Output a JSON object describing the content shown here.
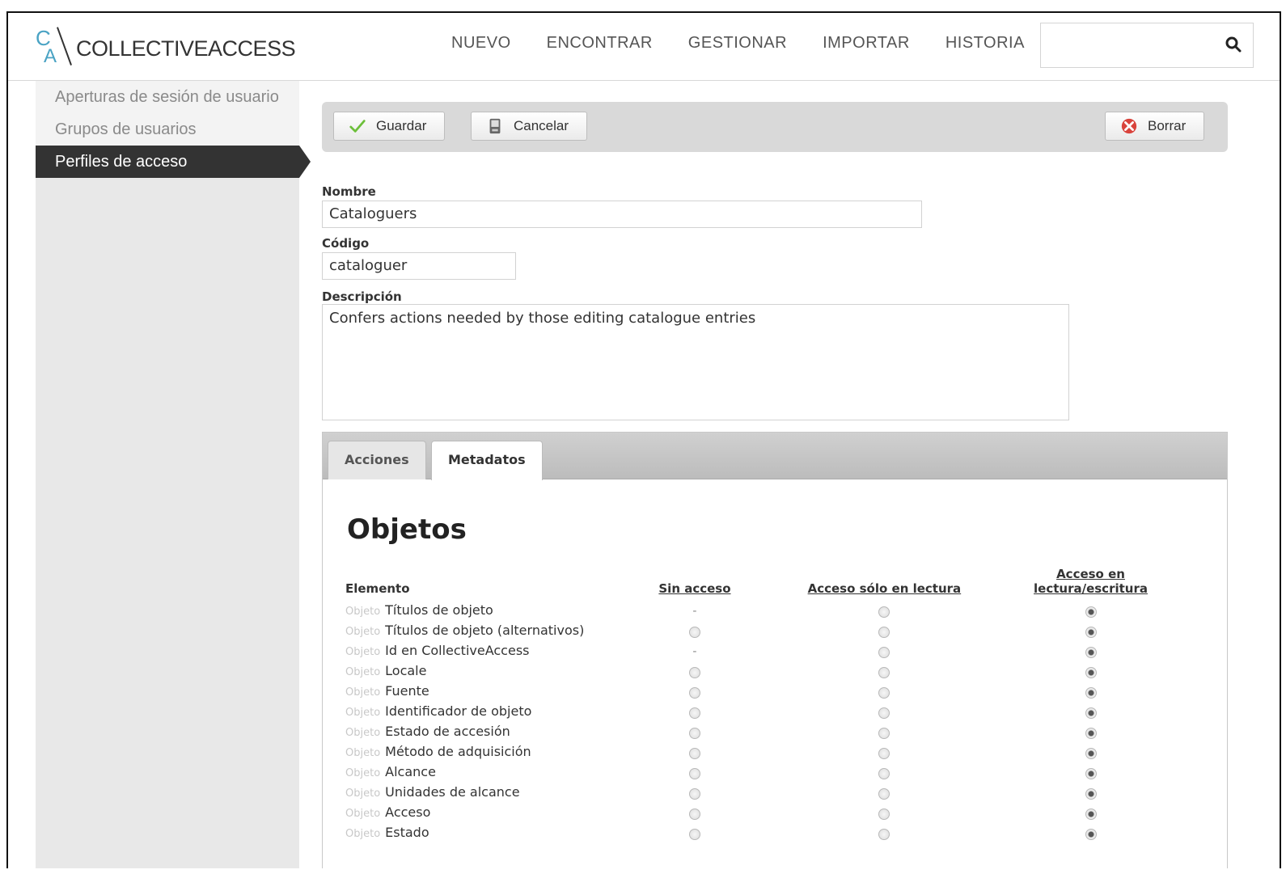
{
  "header": {
    "logo_text": "COLLECTIVEACCESS",
    "logo_c": "C",
    "logo_a": "A",
    "nav": [
      "NUEVO",
      "ENCONTRAR",
      "GESTIONAR",
      "IMPORTAR",
      "HISTORIA"
    ],
    "search_value": ""
  },
  "sidebar": {
    "items": [
      {
        "label": "Aperturas de sesión de usuario"
      },
      {
        "label": "Grupos de usuarios"
      },
      {
        "label": "Perfiles de acceso"
      }
    ]
  },
  "toolbar": {
    "save_label": "Guardar",
    "cancel_label": "Cancelar",
    "delete_label": "Borrar"
  },
  "form": {
    "nombre_label": "Nombre",
    "nombre_value": "Cataloguers",
    "codigo_label": "Código",
    "codigo_value": "cataloguer",
    "descripcion_label": "Descripción",
    "descripcion_value": "Confers actions needed by those editing catalogue entries"
  },
  "tabs": [
    {
      "label": "Acciones"
    },
    {
      "label": "Metadatos"
    }
  ],
  "section_title": "Objetos",
  "table": {
    "headers": {
      "element": "Elemento",
      "none": "Sin acceso",
      "read": "Acceso sólo en lectura",
      "rw_line1": "Acceso en",
      "rw_line2": "lectura/escritura"
    },
    "prefix": "Objeto",
    "rows": [
      {
        "label": "Títulos de objeto",
        "none": "-",
        "selected": "rw"
      },
      {
        "label": "Títulos de objeto (alternativos)",
        "none": "radio",
        "selected": "rw"
      },
      {
        "label": "Id en CollectiveAccess",
        "none": "-",
        "selected": "rw"
      },
      {
        "label": "Locale",
        "none": "radio",
        "selected": "rw"
      },
      {
        "label": "Fuente",
        "none": "radio",
        "selected": "rw"
      },
      {
        "label": "Identificador de objeto",
        "none": "radio",
        "selected": "rw"
      },
      {
        "label": "Estado de accesión",
        "none": "radio",
        "selected": "rw"
      },
      {
        "label": "Método de adquisición",
        "none": "radio",
        "selected": "rw"
      },
      {
        "label": "Alcance",
        "none": "radio",
        "selected": "rw"
      },
      {
        "label": "Unidades de alcance",
        "none": "radio",
        "selected": "rw"
      },
      {
        "label": "Acceso",
        "none": "radio",
        "selected": "rw"
      },
      {
        "label": "Estado",
        "none": "radio",
        "selected": "rw"
      }
    ]
  },
  "colors": {
    "accent": "#4aa3c4",
    "sidebar_active": "#333333",
    "toolbar_bg": "#d9d9d9"
  }
}
